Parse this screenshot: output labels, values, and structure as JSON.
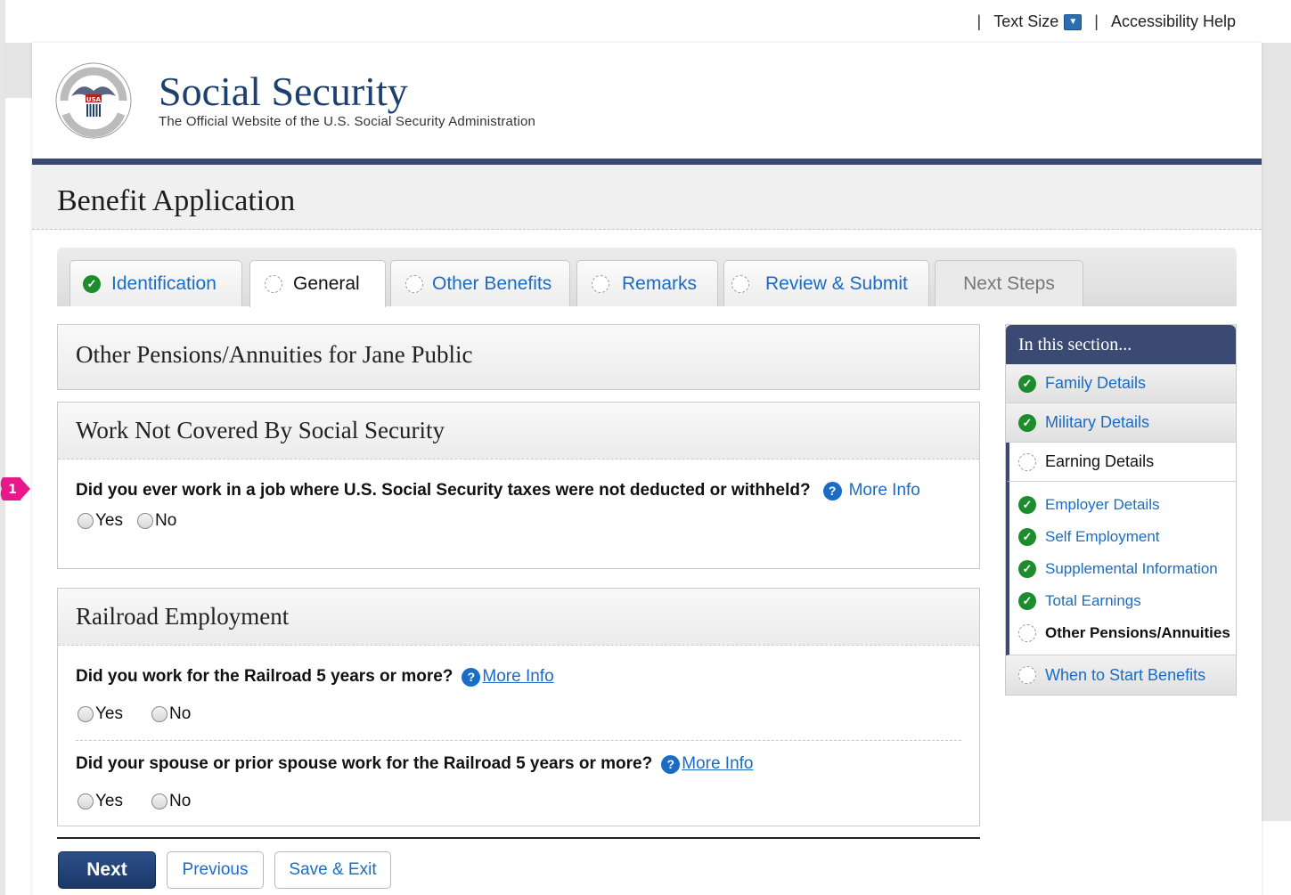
{
  "utility": {
    "sep1": "|",
    "text_size": "Text Size",
    "text_size_toggle": "▼",
    "sep2": "|",
    "accessibility_help": "Accessibility Help"
  },
  "masthead": {
    "title": "Social Security",
    "subtitle": "The Official Website of the U.S. Social Security Administration"
  },
  "app": {
    "title": "Benefit Application"
  },
  "tabs": [
    {
      "label": "Identification",
      "state": "complete"
    },
    {
      "label": "General",
      "state": "active"
    },
    {
      "label": "Other Benefits",
      "state": "incomplete"
    },
    {
      "label": "Remarks",
      "state": "incomplete"
    },
    {
      "label": "Review & Submit",
      "state": "incomplete"
    },
    {
      "label": "Next Steps",
      "state": "disabled"
    }
  ],
  "page_heading": "Other Pensions/Annuities for Jane Public",
  "sections": {
    "work_not_covered": {
      "title": "Work Not Covered By Social Security",
      "step_number": "1",
      "question": "Did you ever work in a job where U.S. Social Security taxes were not deducted or withheld?",
      "more_info": "More Info",
      "yes": "Yes",
      "no": "No"
    },
    "railroad": {
      "title": "Railroad Employment",
      "q1": "Did you work for the Railroad 5 years or more?",
      "q1_more_info": "More Info",
      "q2": "Did your spouse or prior spouse work for the Railroad 5 years or more?",
      "q2_more_info": "More Info",
      "yes": "Yes",
      "no": "No"
    }
  },
  "sidebar": {
    "heading": "In this section...",
    "items": [
      {
        "label": "Family Details",
        "state": "complete"
      },
      {
        "label": "Military Details",
        "state": "complete"
      },
      {
        "label": "Earning Details",
        "state": "current"
      },
      {
        "label": "When to Start Benefits",
        "state": "incomplete"
      }
    ],
    "sub_items": [
      {
        "label": "Employer Details",
        "state": "complete"
      },
      {
        "label": "Self Employment",
        "state": "complete"
      },
      {
        "label": "Supplemental Information",
        "state": "complete"
      },
      {
        "label": "Total Earnings",
        "state": "complete"
      },
      {
        "label": "Other Pensions/Annuities",
        "state": "current"
      }
    ]
  },
  "buttons": {
    "next": "Next",
    "previous": "Previous",
    "save_exit": "Save & Exit"
  },
  "colors": {
    "navy": "#3b4a72",
    "link": "#1a6cc4",
    "check_green": "#1d8c2c",
    "step_badge": "#e8178a"
  }
}
